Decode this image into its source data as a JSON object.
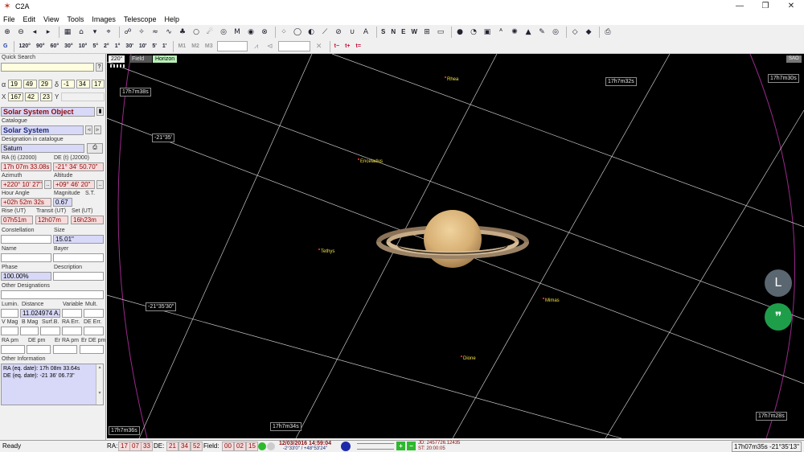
{
  "window": {
    "title": "C2A",
    "min": "—",
    "max": "❐",
    "close": "✕"
  },
  "menu": [
    "File",
    "Edit",
    "View",
    "Tools",
    "Images",
    "Telescope",
    "Help"
  ],
  "toolbar2": {
    "go": "G",
    "fov_buttons": [
      "120°",
      "90°",
      "60°",
      "30°",
      "10°",
      "5°",
      "2°",
      "1°",
      "30'",
      "10'",
      "5'",
      "1'"
    ],
    "mag_buttons": [
      "M1",
      "M2",
      "M3"
    ],
    "time_buttons": [
      "t−",
      "t+",
      "t="
    ]
  },
  "panel": {
    "quick_search": {
      "label": "Quick Search",
      "value": "",
      "help": "?"
    },
    "alpha": {
      "label": "α",
      "h": "19",
      "m": "49",
      "s": "29"
    },
    "delta": {
      "label": "δ",
      "d": "-1",
      "m": "34",
      "s": "17"
    },
    "x": {
      "label": "X",
      "a": "167",
      "b": "42",
      "c": "23"
    },
    "y": {
      "label": "Y",
      "value": ""
    },
    "object_type": "Solar System Object",
    "catalogue_label": "Catalogue",
    "catalogue": "Solar System",
    "designation_label": "Designation in catalogue",
    "designation": "Saturn",
    "ra_label": "RA (t) (J2000)",
    "de_label": "DE (t) (J2000)",
    "ra": "17h 07m 33.08s",
    "de": "-21° 34' 50.70\"",
    "azimuth_label": "Azimuth",
    "altitude_label": "Altitude",
    "azimuth": "+220° 10' 27\"",
    "altitude": "+09° 46' 20\"",
    "hour_angle_label": "Hour Angle",
    "magnitude_label": "Magnitude",
    "st_label": "S.T.",
    "hour_angle": "+02h 52m 32s",
    "magnitude": "0.67",
    "rise_label": "Rise (UT)",
    "transit_label": "Transit (UT)",
    "set_label": "Set (UT)",
    "rise": "07h51m",
    "transit": "12h07m",
    "set": "16h23m",
    "constellation_label": "Constellation",
    "size_label": "Size",
    "constellation": "",
    "size": "15.01\"",
    "name_label": "Name",
    "bayer_label": "Bayer",
    "phase_label": "Phase",
    "description_label": "Description",
    "phase": "100.00%",
    "other_designations_label": "Other Designations",
    "lumin_label": "Lumin.",
    "distance_label": "Distance",
    "variable_label": "Variable",
    "mult_label": "Mult.",
    "distance": "11.024974 A.",
    "vmag_label": "V Mag",
    "bmag_label": "B Mag",
    "surfb_label": "Surf.B.",
    "raerr_label": "RA Err.",
    "deerr_label": "DE Err.",
    "rapm_label": "RA pm",
    "depm_label": "DE pm",
    "errapm_label": "Er RA pm",
    "erdepm_label": "Er DE pm",
    "other_info_label": "Other Information",
    "other_info_line1": "RA (eq. date): 17h 08m 33.64s",
    "other_info_line2": "DE (eq. date): -21 36' 06.73\""
  },
  "map": {
    "tabs": {
      "fov": "220°",
      "field": "Field",
      "horizon": "Horizon"
    },
    "sao": "SAO",
    "grid_labels": {
      "ra_32s": "17h7m32s",
      "ra_30s": "17h7m30s",
      "ra_38s": "17h7m38s",
      "dec_35": "-21°35'",
      "dec_3530": "-21°35'30\"",
      "ra_36s": "17h7m36s",
      "ra_34s": "17h7m34s",
      "ra_28s": "17h7m28s"
    },
    "moons": {
      "rhea": "Rhea",
      "enceladus": "Enceladus",
      "tethys": "Tethys",
      "mimas": "Mimas",
      "dione": "Dione"
    },
    "fab_l": "L",
    "fab_quote": "❞"
  },
  "status": {
    "ready": "Ready",
    "ra_label": "RA:",
    "ra_h": "17",
    "ra_m": "07",
    "ra_s": "33",
    "de_label": "DE:",
    "de_d": "21",
    "de_m": "34",
    "de_s": "52",
    "field_label": "Field:",
    "field_h": "00",
    "field_m": "02",
    "field_s": "15",
    "datetime": "12/03/2016 14:59:04",
    "location": "-2°33'0\" / +48°53'24\"",
    "jd": "JD: 2457726.12435",
    "st": "ST: 20:00:05",
    "cursor": "17h07m35s -21°35'13\""
  },
  "colors": {
    "map_bg": "#000000",
    "grid": "#c8c8c8",
    "circle": "#9a2a8a",
    "moon_label": "#f0e040",
    "fab_gray": "#5a6670",
    "fab_green": "#1f9e4a"
  }
}
